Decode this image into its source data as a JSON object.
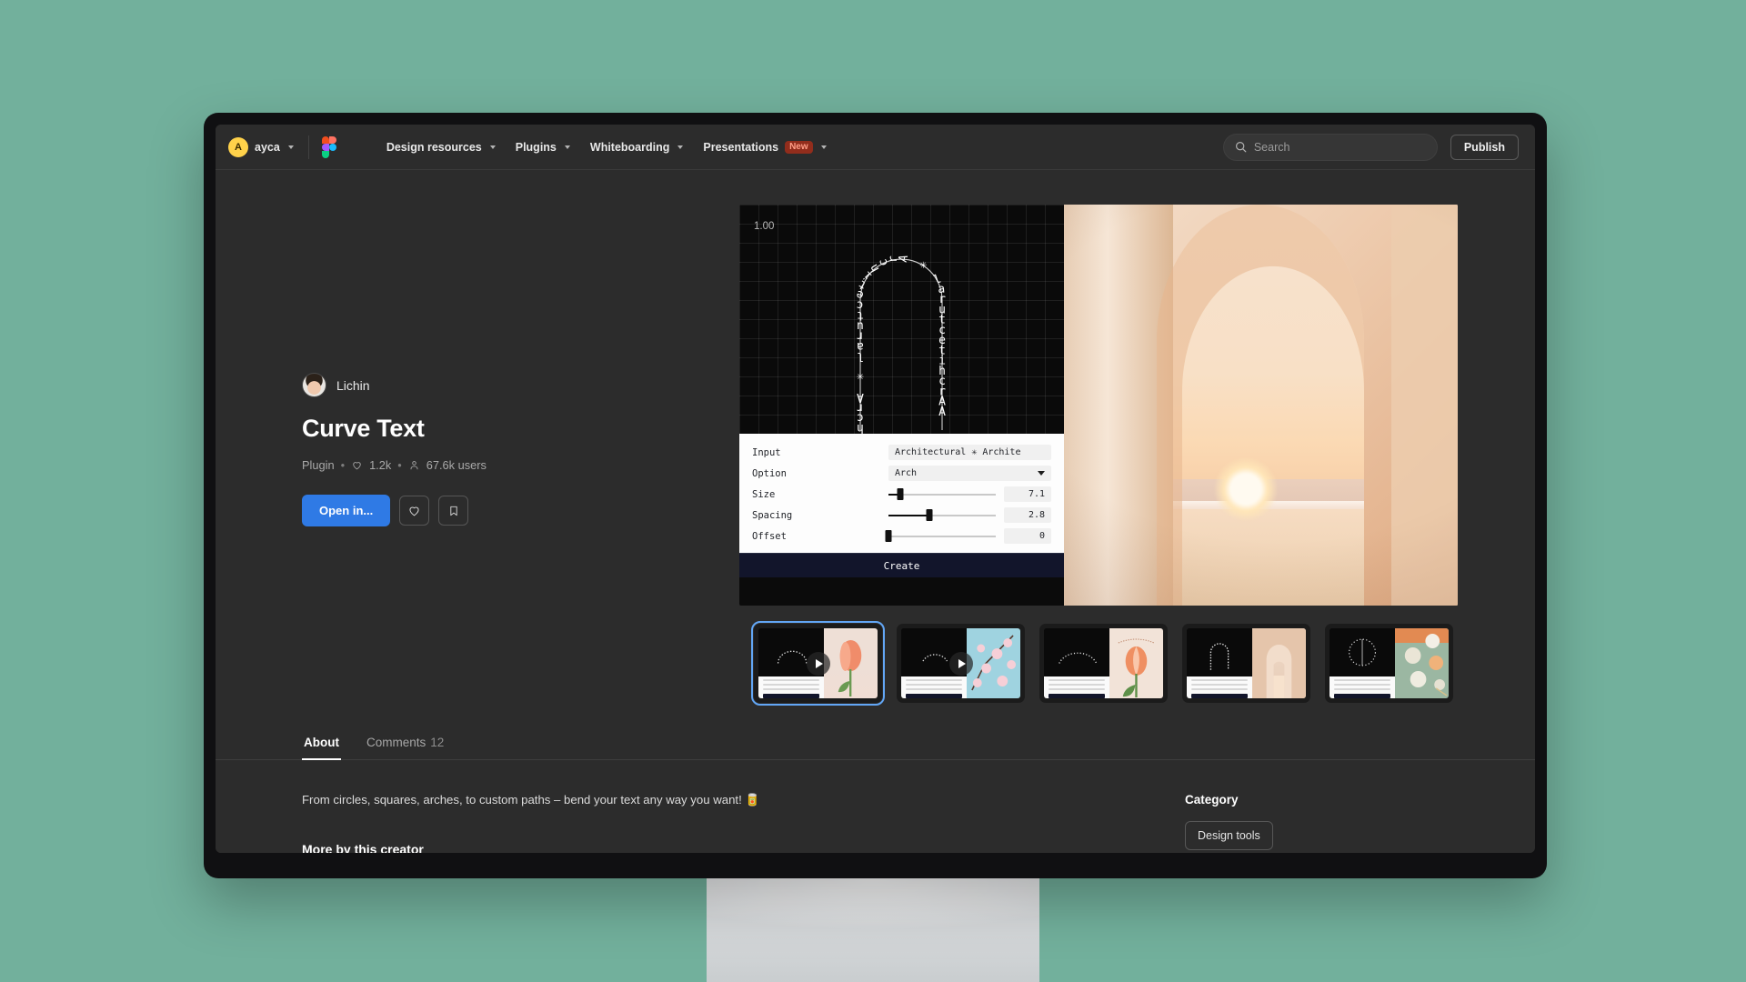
{
  "nav": {
    "user": {
      "initial": "A",
      "name": "ayca"
    },
    "logo_name": "figma-logo",
    "links": [
      {
        "label": "Design resources",
        "badge": ""
      },
      {
        "label": "Plugins",
        "badge": ""
      },
      {
        "label": "Whiteboarding",
        "badge": ""
      },
      {
        "label": "Presentations",
        "badge": "New"
      }
    ],
    "search_placeholder": "Search",
    "publish_label": "Publish"
  },
  "resource": {
    "creator": "Lichin",
    "title": "Curve Text",
    "type": "Plugin",
    "likes": "1.2k",
    "users": "67.6k users",
    "separator": "•",
    "open_label": "Open in...",
    "like_icon": "heart-icon",
    "save_icon": "bookmark-icon"
  },
  "preview": {
    "canvas_zoom": "1.00",
    "curved_text": "AArchitectural ✳ Architectural ✳ Arch",
    "panel": {
      "rows": [
        {
          "label": "Input",
          "type": "text",
          "value": "Architectural ✳ Archite"
        },
        {
          "label": "Option",
          "type": "select",
          "value": "Arch"
        },
        {
          "label": "Size",
          "type": "slider",
          "value": "7.1",
          "pct": 11
        },
        {
          "label": "Spacing",
          "type": "slider",
          "value": "2.8",
          "pct": 38
        },
        {
          "label": "Offset",
          "type": "slider",
          "value": "0",
          "pct": 0
        }
      ],
      "create_label": "Create"
    },
    "cursor": "horizontal-resize-cursor"
  },
  "thumbnails": [
    {
      "name": "thumbnail-1",
      "kind": "video",
      "selected": true,
      "photo": "tulip"
    },
    {
      "name": "thumbnail-2",
      "kind": "video",
      "selected": false,
      "photo": "blossom"
    },
    {
      "name": "thumbnail-3",
      "kind": "image",
      "selected": false,
      "photo": "tulip"
    },
    {
      "name": "thumbnail-4",
      "kind": "image",
      "selected": false,
      "photo": "arch"
    },
    {
      "name": "thumbnail-5",
      "kind": "image",
      "selected": false,
      "photo": "dumplings"
    }
  ],
  "tabs": [
    {
      "label": "About",
      "count": "",
      "active": true
    },
    {
      "label": "Comments",
      "count": "12",
      "active": false
    }
  ],
  "about": {
    "description": "From circles, squares, arches, to custom paths – bend your text any way you want! 🥫",
    "more_by_creator": "More by this creator"
  },
  "sidebar": {
    "category_title": "Category",
    "category_value": "Design tools"
  },
  "colors": {
    "page_background": "#72b09c",
    "app_background": "#2c2c2c",
    "accent_blue": "#2f7ae5",
    "badge_new_bg": "#922d1c",
    "badge_new_text": "#ff9d86",
    "avatar_yellow": "#ffd24a"
  }
}
